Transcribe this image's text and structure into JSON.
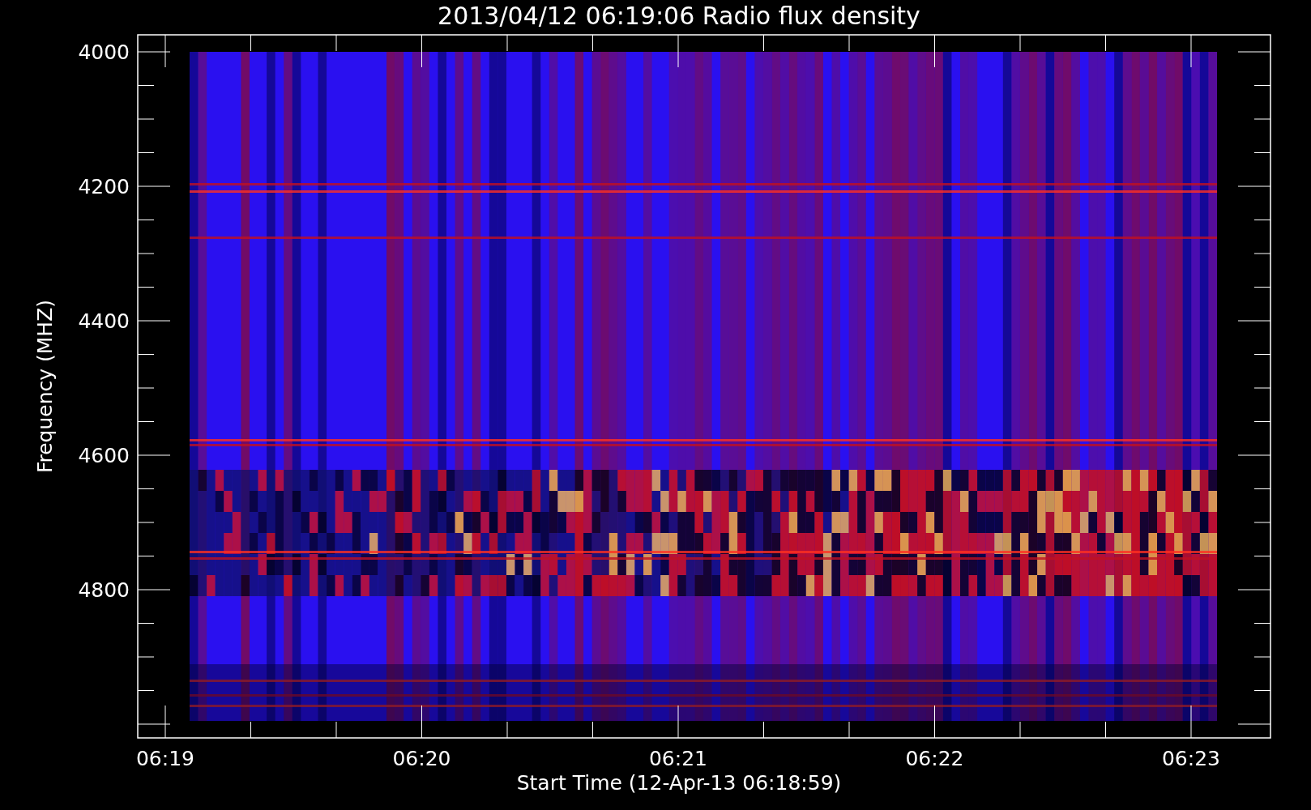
{
  "title": "2013/04/12 06:19:06 Radio flux density",
  "y_axis": {
    "label": "Frequency (MHZ)",
    "ticks": [
      "4000",
      "4200",
      "4400",
      "4600",
      "4800"
    ]
  },
  "x_axis": {
    "label": "Start Time (12-Apr-13 06:18:59)",
    "ticks": [
      "06:19",
      "06:20",
      "06:21",
      "06:22",
      "06:23"
    ]
  }
}
